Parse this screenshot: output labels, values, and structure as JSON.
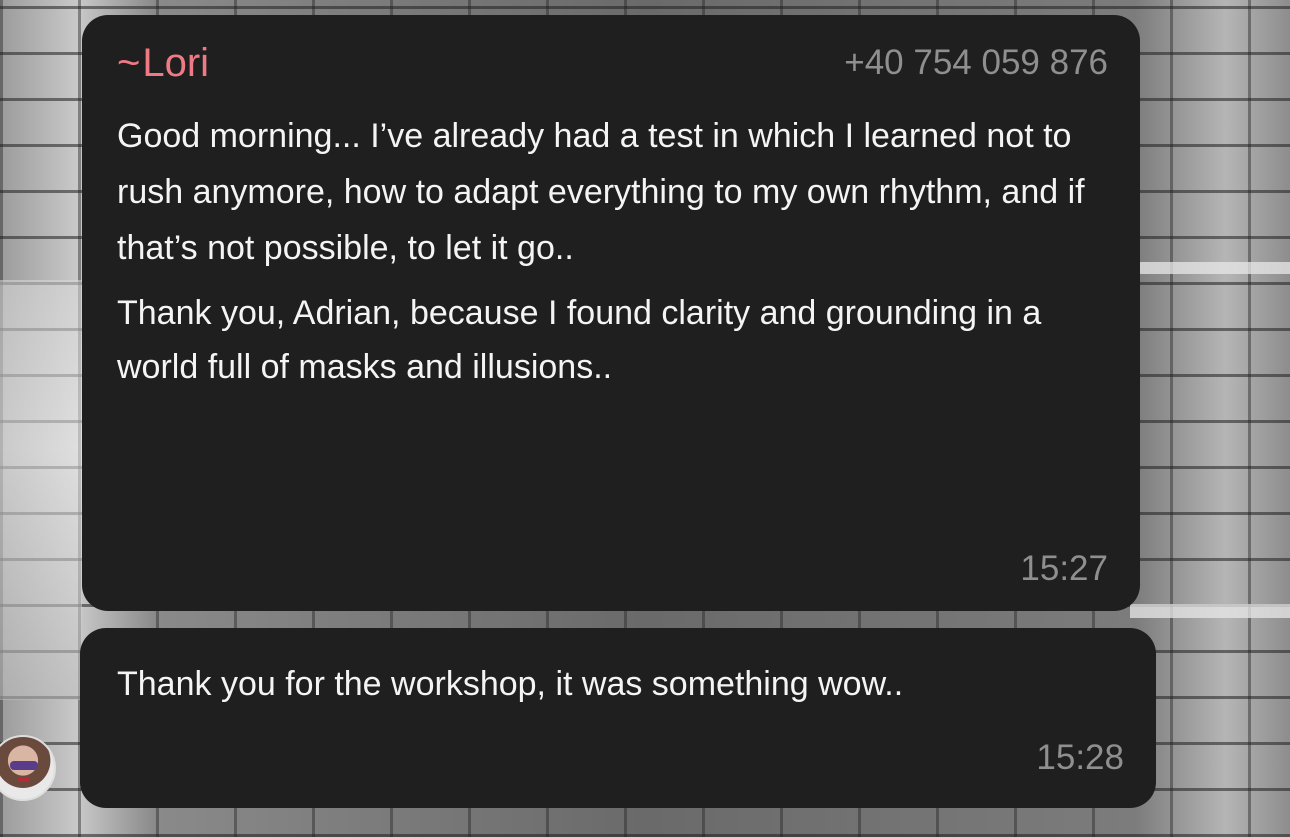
{
  "messages": [
    {
      "sender": "Lori",
      "sender_prefix": "~",
      "phone": "+40 754 059 876",
      "paragraphs": [
        "Good morning... I’ve already had a test in which I learned not to rush anymore, how to adapt everything to my own rhythm, and if that’s not possible, to let it go..",
        "Thank you, Adrian, because I found clarity and grounding in a world full of masks and illusions.."
      ],
      "time": "15:27"
    },
    {
      "text": "Thank you for the workshop, it was something wow..",
      "time": "15:28"
    }
  ],
  "colors": {
    "bubble": "#1f1f1f",
    "sender_name": "#f07a84",
    "meta_text": "#8f8f8f",
    "message_text": "#f4f4f4"
  }
}
